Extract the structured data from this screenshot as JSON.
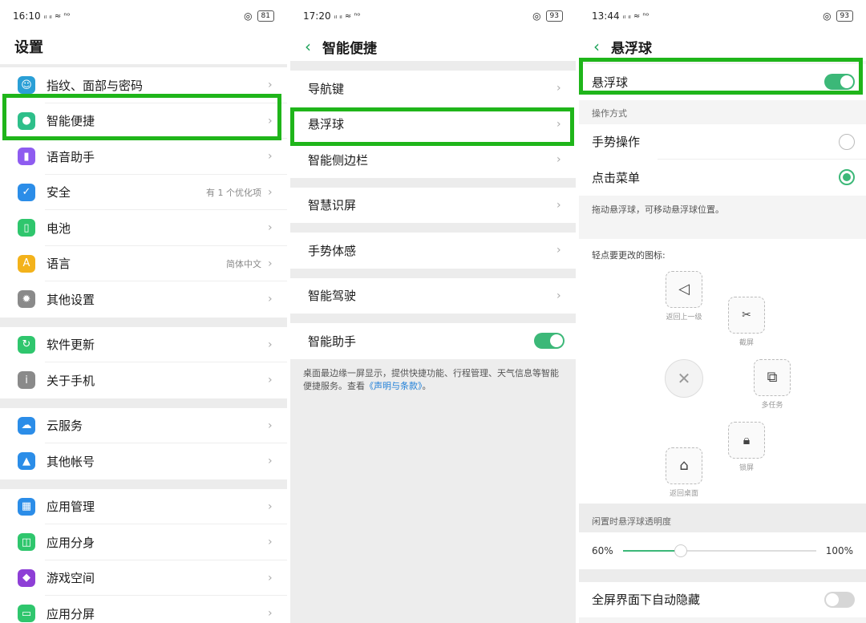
{
  "panel1": {
    "status": {
      "time": "16:10",
      "signal": "ᵢₗ ᵢₗ ≈ ⁿᵒ",
      "battery": "81"
    },
    "title": "设置",
    "group1": [
      {
        "label": "指纹、面部与密码",
        "hint": "",
        "icon": "fingerprint-icon",
        "color": "#2a9fd6"
      },
      {
        "label": "智能便捷",
        "hint": "",
        "icon": "smart-assist-icon",
        "color": "#2ebf8a"
      },
      {
        "label": "语音助手",
        "hint": "",
        "icon": "microphone-icon",
        "color": "#8e5cf0"
      },
      {
        "label": "安全",
        "hint": "有 1 个优化项",
        "icon": "shield-icon",
        "color": "#2b8de8"
      },
      {
        "label": "电池",
        "hint": "",
        "icon": "battery-icon",
        "color": "#2fc66d"
      },
      {
        "label": "语言",
        "hint": "简体中文",
        "icon": "language-icon",
        "color": "#f3b21b"
      },
      {
        "label": "其他设置",
        "hint": "",
        "icon": "gear-icon",
        "color": "#8a8a8a"
      }
    ],
    "group2": [
      {
        "label": "软件更新",
        "hint": "",
        "icon": "update-icon",
        "color": "#2fc66d"
      },
      {
        "label": "关于手机",
        "hint": "",
        "icon": "info-icon",
        "color": "#8a8a8a"
      }
    ],
    "group3": [
      {
        "label": "云服务",
        "hint": "",
        "icon": "cloud-icon",
        "color": "#2b8de8"
      },
      {
        "label": "其他帐号",
        "hint": "",
        "icon": "person-icon",
        "color": "#2b8de8"
      }
    ],
    "group4": [
      {
        "label": "应用管理",
        "hint": "",
        "icon": "apps-grid-icon",
        "color": "#2b8de8"
      },
      {
        "label": "应用分身",
        "hint": "",
        "icon": "clone-icon",
        "color": "#2fc66d"
      },
      {
        "label": "游戏空间",
        "hint": "",
        "icon": "game-cube-icon",
        "color": "#8e3fd6"
      },
      {
        "label": "应用分屏",
        "hint": "",
        "icon": "split-screen-icon",
        "color": "#2fc66d"
      }
    ]
  },
  "panel2": {
    "status": {
      "time": "17:20",
      "signal": "ᵢₗ ᵢₗ ≈ ⁿᵒ",
      "battery": "93"
    },
    "title": "智能便捷",
    "items": [
      {
        "label": "导航键"
      },
      {
        "label": "悬浮球"
      },
      {
        "label": "智能侧边栏"
      },
      {
        "label": "智慧识屏"
      },
      {
        "label": "手势体感"
      },
      {
        "label": "智能驾驶"
      },
      {
        "label": "智能助手"
      }
    ],
    "note": "桌面最边缘一屏显示，提供快捷功能、行程管理、天气信息等智能便捷服务。查看",
    "note_link": "《声明与条款》",
    "note_end": "。"
  },
  "panel3": {
    "status": {
      "time": "13:44",
      "signal": "ᵢₗ ᵢₗ ≈ ⁿᵒ",
      "battery": "93"
    },
    "title": "悬浮球",
    "toggle_label": "悬浮球",
    "section_mode": "操作方式",
    "mode_options": [
      {
        "label": "手势操作",
        "selected": false
      },
      {
        "label": "点击菜单",
        "selected": true
      }
    ],
    "drag_hint": "拖动悬浮球，可移动悬浮球位置。",
    "icons_title": "轻点要更改的图标:",
    "icon_captions": {
      "back": "返回上一级",
      "screenshot": "截屏",
      "multitask": "多任务",
      "lock": "锁屏",
      "home": "返回桌面"
    },
    "transparency_title": "闲置时悬浮球透明度",
    "transparency_min": "60%",
    "transparency_max": "100%",
    "transparency_value": 0.3,
    "auto_hide_label": "全屏界面下自动隐藏"
  }
}
